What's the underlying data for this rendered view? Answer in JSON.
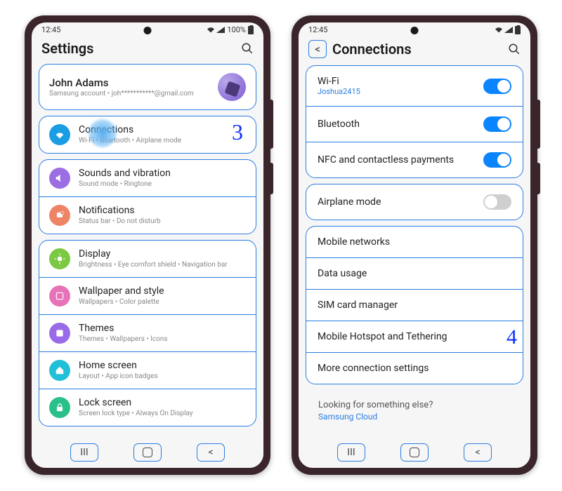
{
  "statusbar": {
    "time": "12:45",
    "battery": "100%"
  },
  "left": {
    "title": "Settings",
    "account": {
      "name": "John Adams",
      "sub": "Samsung account • joh***********@gmail.com"
    },
    "step_marker": "3",
    "groups": [
      {
        "items": [
          {
            "icon": "wifi",
            "color": "ic-blue",
            "title": "Connections",
            "sub": "Wi-Fi • Bluetooth • Airplane mode",
            "tap": true
          }
        ]
      },
      {
        "items": [
          {
            "icon": "vol",
            "color": "ic-purple",
            "title": "Sounds and vibration",
            "sub": "Sound mode • Ringtone"
          },
          {
            "icon": "bell",
            "color": "ic-coral",
            "title": "Notifications",
            "sub": "Status bar • Do not disturb"
          }
        ]
      },
      {
        "items": [
          {
            "icon": "sun",
            "color": "ic-green",
            "title": "Display",
            "sub": "Brightness • Eye comfort shield • Navigation bar"
          },
          {
            "icon": "wall",
            "color": "ic-pink",
            "title": "Wallpaper and style",
            "sub": "Wallpapers • Color palette"
          },
          {
            "icon": "theme",
            "color": "ic-violet",
            "title": "Themes",
            "sub": "Themes • Wallpapers • Icons"
          },
          {
            "icon": "home",
            "color": "ic-cyan",
            "title": "Home screen",
            "sub": "Layout • App icon badges"
          },
          {
            "icon": "lock",
            "color": "ic-teal",
            "title": "Lock screen",
            "sub": "Screen lock type • Always On Display"
          }
        ]
      }
    ]
  },
  "right": {
    "title": "Connections",
    "step_marker": "4",
    "groups": [
      {
        "rows": [
          {
            "title": "Wi-Fi",
            "sub": "Joshua2415",
            "toggle": "on"
          },
          {
            "title": "Bluetooth",
            "toggle": "on"
          },
          {
            "title": "NFC and contactless payments",
            "toggle": "on"
          }
        ]
      },
      {
        "rows": [
          {
            "title": "Airplane mode",
            "toggle": "off"
          }
        ]
      },
      {
        "rows": [
          {
            "title": "Mobile networks"
          },
          {
            "title": "Data usage"
          },
          {
            "title": "SIM card manager"
          },
          {
            "title": "Mobile Hotspot and Tethering",
            "step": true
          },
          {
            "title": "More connection settings"
          }
        ]
      }
    ],
    "footer": {
      "hint": "Looking for something else?",
      "link": "Samsung Cloud"
    }
  }
}
